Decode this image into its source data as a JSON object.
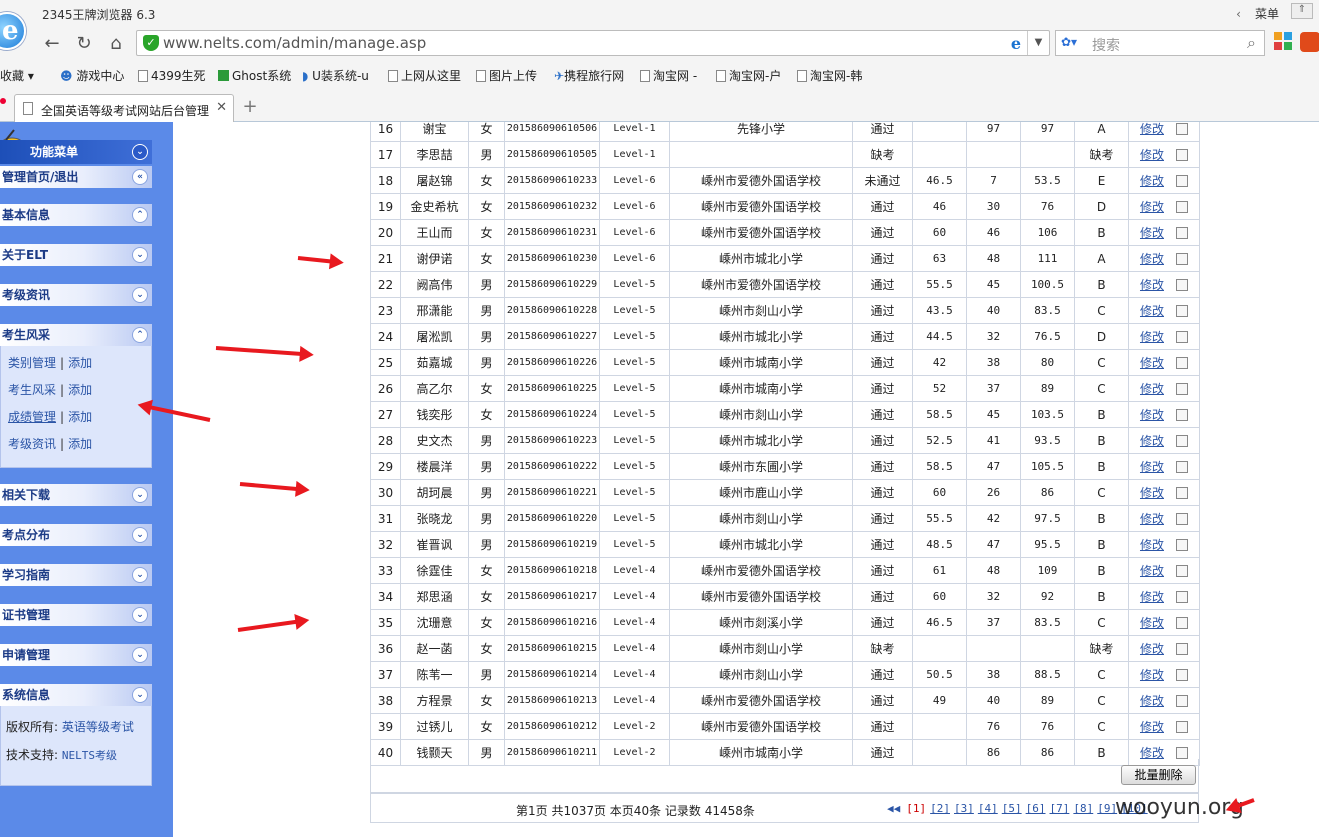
{
  "browser": {
    "app_title": "2345王牌浏览器 6.3",
    "menu_label": "菜单",
    "url": "www.nelts.com/admin/manage.asp",
    "search_placeholder": "搜索",
    "bookmarks": [
      "收藏",
      "游戏中心",
      "4399生死",
      "Ghost系统",
      "U装系统-u",
      "上网从这里",
      "图片上传",
      "携程旅行网",
      "淘宝网 -",
      "淘宝网-户",
      "淘宝网-韩"
    ],
    "tab_title": "全国英语等级考试网站后台管理"
  },
  "sidebar": {
    "menu_title": "功能菜单",
    "sections": [
      {
        "label": "管理首页/退出"
      },
      {
        "label": "基本信息"
      },
      {
        "label": "关于ELT"
      },
      {
        "label": "考级资讯"
      },
      {
        "label": "考生风采",
        "links": [
          {
            "label": "类别管理",
            "add": "添加"
          },
          {
            "label": "考生风采",
            "add": "添加"
          },
          {
            "label": "成绩管理",
            "add": "添加"
          },
          {
            "label": "考级资讯",
            "add": "添加"
          }
        ]
      },
      {
        "label": "相关下载"
      },
      {
        "label": "考点分布"
      },
      {
        "label": "学习指南"
      },
      {
        "label": "证书管理"
      },
      {
        "label": "申请管理"
      },
      {
        "label": "系统信息",
        "info": [
          {
            "label": "版权所有:",
            "value": "英语等级考试"
          },
          {
            "label": "技术支持:",
            "value": "NELTS考级"
          }
        ]
      }
    ]
  },
  "table": {
    "edit_label": "修改",
    "rows": [
      [
        "16",
        "谢宝",
        "女",
        "201586090610506",
        "Level-1",
        "先锋小学",
        "通过",
        "",
        "97",
        "97",
        "A"
      ],
      [
        "17",
        "李思喆",
        "男",
        "201586090610505",
        "Level-1",
        "",
        "缺考",
        "",
        "",
        "",
        "缺考"
      ],
      [
        "18",
        "屠赵锦",
        "女",
        "201586090610233",
        "Level-6",
        "嵊州市爱德外国语学校",
        "未通过",
        "46.5",
        "7",
        "53.5",
        "E"
      ],
      [
        "19",
        "金史希杭",
        "女",
        "201586090610232",
        "Level-6",
        "嵊州市爱德外国语学校",
        "通过",
        "46",
        "30",
        "76",
        "D"
      ],
      [
        "20",
        "王山而",
        "女",
        "201586090610231",
        "Level-6",
        "嵊州市爱德外国语学校",
        "通过",
        "60",
        "46",
        "106",
        "B"
      ],
      [
        "21",
        "谢伊诺",
        "女",
        "201586090610230",
        "Level-6",
        "嵊州市城北小学",
        "通过",
        "63",
        "48",
        "111",
        "A"
      ],
      [
        "22",
        "阙高伟",
        "男",
        "201586090610229",
        "Level-5",
        "嵊州市爱德外国语学校",
        "通过",
        "55.5",
        "45",
        "100.5",
        "B"
      ],
      [
        "23",
        "邢潇能",
        "男",
        "201586090610228",
        "Level-5",
        "嵊州市剡山小学",
        "通过",
        "43.5",
        "40",
        "83.5",
        "C"
      ],
      [
        "24",
        "屠淞凯",
        "男",
        "201586090610227",
        "Level-5",
        "嵊州市城北小学",
        "通过",
        "44.5",
        "32",
        "76.5",
        "D"
      ],
      [
        "25",
        "茹嘉城",
        "男",
        "201586090610226",
        "Level-5",
        "嵊州市城南小学",
        "通过",
        "42",
        "38",
        "80",
        "C"
      ],
      [
        "26",
        "高乙尔",
        "女",
        "201586090610225",
        "Level-5",
        "嵊州市城南小学",
        "通过",
        "52",
        "37",
        "89",
        "C"
      ],
      [
        "27",
        "钱奕彤",
        "女",
        "201586090610224",
        "Level-5",
        "嵊州市剡山小学",
        "通过",
        "58.5",
        "45",
        "103.5",
        "B"
      ],
      [
        "28",
        "史文杰",
        "男",
        "201586090610223",
        "Level-5",
        "嵊州市城北小学",
        "通过",
        "52.5",
        "41",
        "93.5",
        "B"
      ],
      [
        "29",
        "楼晨洋",
        "男",
        "201586090610222",
        "Level-5",
        "嵊州市东圃小学",
        "通过",
        "58.5",
        "47",
        "105.5",
        "B"
      ],
      [
        "30",
        "胡珂晨",
        "男",
        "201586090610221",
        "Level-5",
        "嵊州市鹿山小学",
        "通过",
        "60",
        "26",
        "86",
        "C"
      ],
      [
        "31",
        "张晓龙",
        "男",
        "201586090610220",
        "Level-5",
        "嵊州市剡山小学",
        "通过",
        "55.5",
        "42",
        "97.5",
        "B"
      ],
      [
        "32",
        "崔晋讽",
        "男",
        "201586090610219",
        "Level-5",
        "嵊州市城北小学",
        "通过",
        "48.5",
        "47",
        "95.5",
        "B"
      ],
      [
        "33",
        "徐霆佳",
        "女",
        "201586090610218",
        "Level-4",
        "嵊州市爱德外国语学校",
        "通过",
        "61",
        "48",
        "109",
        "B"
      ],
      [
        "34",
        "郑思涵",
        "女",
        "201586090610217",
        "Level-4",
        "嵊州市爱德外国语学校",
        "通过",
        "60",
        "32",
        "92",
        "B"
      ],
      [
        "35",
        "沈珊意",
        "女",
        "201586090610216",
        "Level-4",
        "嵊州市剡溪小学",
        "通过",
        "46.5",
        "37",
        "83.5",
        "C"
      ],
      [
        "36",
        "赵一菡",
        "女",
        "201586090610215",
        "Level-4",
        "嵊州市剡山小学",
        "缺考",
        "",
        "",
        "",
        "缺考"
      ],
      [
        "37",
        "陈苇一",
        "男",
        "201586090610214",
        "Level-4",
        "嵊州市剡山小学",
        "通过",
        "50.5",
        "38",
        "88.5",
        "C"
      ],
      [
        "38",
        "方程景",
        "女",
        "201586090610213",
        "Level-4",
        "嵊州市爱德外国语学校",
        "通过",
        "49",
        "40",
        "89",
        "C"
      ],
      [
        "39",
        "过锈儿",
        "女",
        "201586090610212",
        "Level-2",
        "嵊州市爱德外国语学校",
        "通过",
        "",
        "76",
        "76",
        "C"
      ],
      [
        "40",
        "钱颢天",
        "男",
        "201586090610211",
        "Level-2",
        "嵊州市城南小学",
        "通过",
        "",
        "86",
        "86",
        "B"
      ]
    ],
    "batch_delete_label": "批量删除"
  },
  "pager": {
    "info": "第1页 共1037页 本页40条 记录数 41458条",
    "first": "◀◀",
    "current": "[1]",
    "pages": [
      "[2]",
      "[3]",
      "[4]",
      "[5]",
      "[6]",
      "[7]",
      "[8]",
      "[9]",
      "[10]"
    ]
  },
  "watermark": "wooyun.org",
  "colors": {
    "sidebar_bg": "#5b8ae8",
    "menu_title": "#1d4fb8",
    "link": "#2b55a6",
    "arrow": "#e8191f"
  }
}
